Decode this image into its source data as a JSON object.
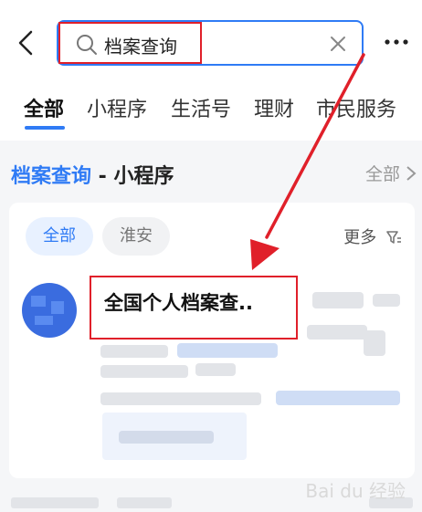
{
  "search": {
    "query": "档案查询"
  },
  "tabs": [
    "全部",
    "小程序",
    "生活号",
    "理财",
    "市民服务"
  ],
  "section": {
    "title_highlight": "档案查询",
    "title_rest": " - 小程序",
    "all_link": "全部"
  },
  "card": {
    "chips": [
      "全部",
      "淮安"
    ],
    "filter_label": "更多",
    "app_title": "全国个人档案查.."
  },
  "watermark": "Bai du 经验",
  "colors": {
    "accent": "#2f7bf5",
    "annotation": "#e0202a"
  }
}
